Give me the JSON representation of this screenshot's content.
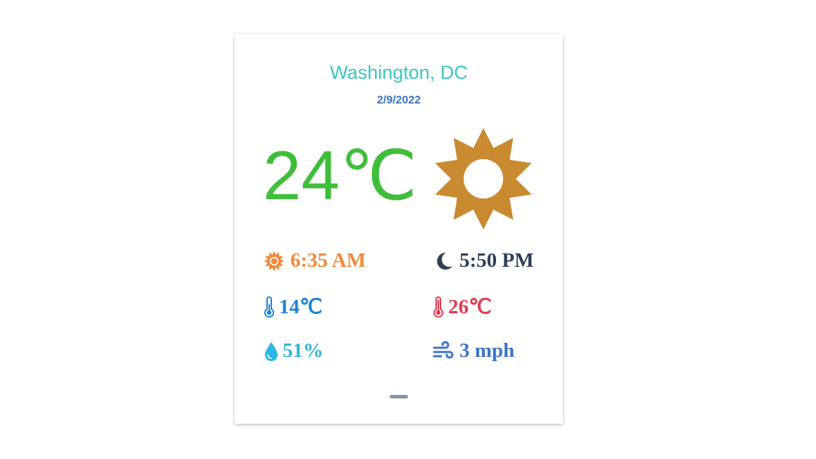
{
  "location": {
    "city": "Washington, DC",
    "date": "2/9/2022"
  },
  "current": {
    "temperature": "24℃",
    "condition_icon": "sun-icon"
  },
  "stats": {
    "sunrise": "6:35 AM",
    "sunset": "5:50 PM",
    "temp_min": "14℃",
    "temp_max": "26℃",
    "humidity": "51%",
    "wind": "3 mph"
  },
  "colors": {
    "city": "#3cc6c2",
    "date": "#3d74c8",
    "temperature": "#3fbe3a",
    "sun": "#c98a30",
    "sunrise": "#f2893a",
    "sunset": "#2e3f57",
    "temp_min": "#1b82d6",
    "temp_max": "#e23a4e",
    "humidity": "#2db6e0",
    "wind": "#3d74c8"
  }
}
